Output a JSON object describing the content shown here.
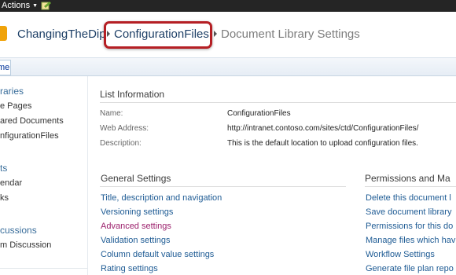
{
  "topbar": {
    "site_actions": "Actions",
    "edit_icon": "edit-page-icon"
  },
  "breadcrumb": {
    "site": "ChangingTheDip",
    "library": "ConfigurationFiles",
    "page": "Document Library Settings"
  },
  "tabstrip": {
    "home": "me"
  },
  "quick_launch": {
    "libraries_head": "raries",
    "library_items": [
      "e Pages",
      "ared Documents",
      "nfigurationFiles"
    ],
    "lists_head": "ts",
    "list_items": [
      "endar",
      "ks"
    ],
    "discussions_head": "cussions",
    "discussion_items": [
      "m Discussion"
    ]
  },
  "list_info": {
    "heading": "List Information",
    "name_label": "Name:",
    "name_value": "ConfigurationFiles",
    "address_label": "Web Address:",
    "address_value": "http://intranet.contoso.com/sites/ctd/ConfigurationFiles/",
    "description_label": "Description:",
    "description_value": "This is the default location to upload configuration files."
  },
  "general_settings": {
    "heading": "General Settings",
    "links": [
      "Title, description and navigation",
      "Versioning settings",
      "Advanced settings",
      "Validation settings",
      "Column default value settings",
      "Rating settings"
    ]
  },
  "permissions": {
    "heading": "Permissions and Ma",
    "links": [
      "Delete this document l",
      "Save document library",
      "Permissions for this do",
      "Manage files which hav",
      "Workflow Settings",
      "Generate file plan repo"
    ]
  },
  "colors": {
    "link": "#1e5b94",
    "visited_link": "#9b1f6b",
    "highlight": "#b51f24",
    "topbar": "#252525",
    "logo": "#f0a30a"
  }
}
